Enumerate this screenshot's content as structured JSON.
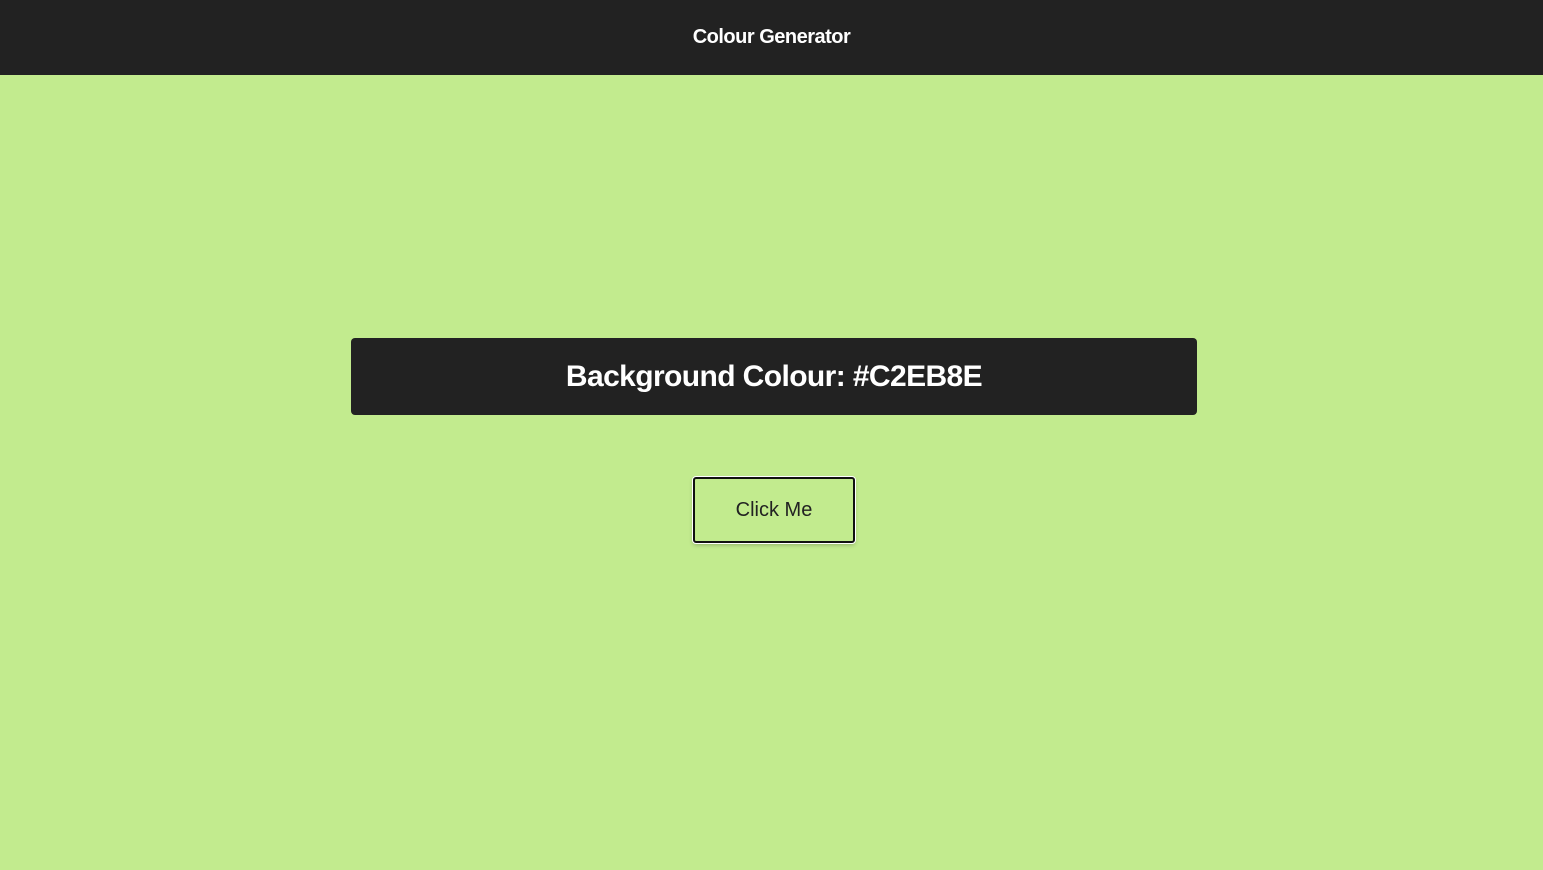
{
  "header": {
    "title": "Colour Generator"
  },
  "main": {
    "colour_label": "Background Colour: #C2EB8E",
    "button_label": "Click Me"
  },
  "colors": {
    "background": "#C2EB8E",
    "header_background": "#222222",
    "banner_background": "#222222",
    "text_light": "#FFFFFF"
  }
}
